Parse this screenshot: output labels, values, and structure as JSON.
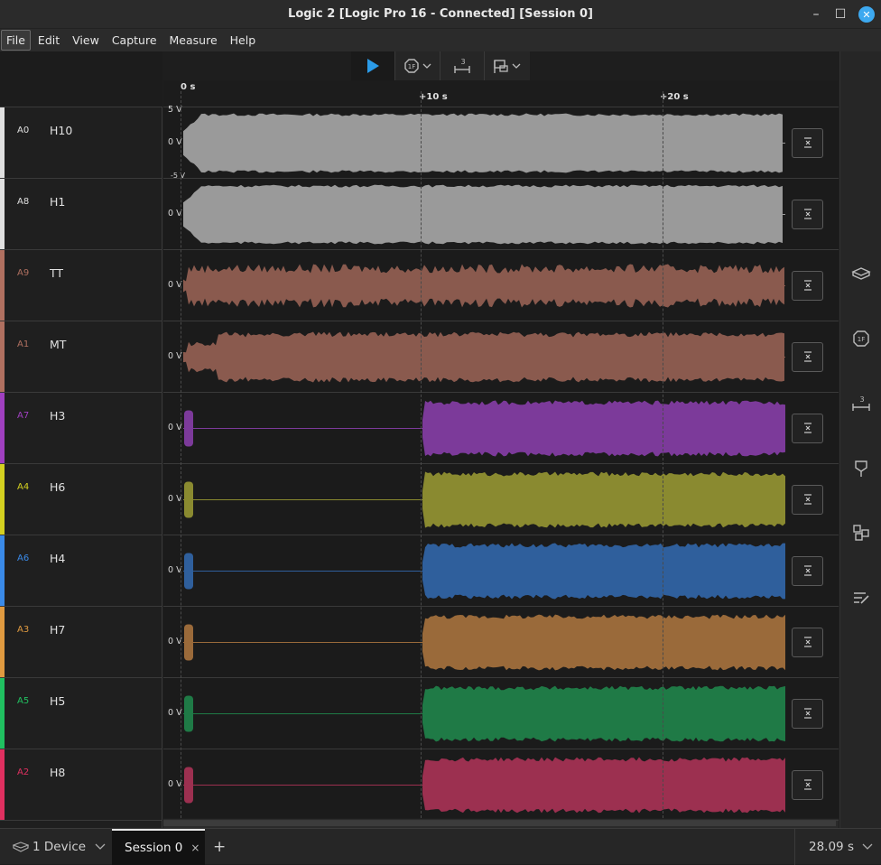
{
  "window": {
    "title": "Logic 2 [Logic Pro 16 - Connected] [Session 0]",
    "minimize_glyph": "–",
    "maximize_glyph": "☐",
    "close_glyph": "✕"
  },
  "menu": [
    "File",
    "Edit",
    "View",
    "Capture",
    "Measure",
    "Help"
  ],
  "toolbar": {
    "start_icon": "play-icon",
    "trigger_icon": "trigger-icon",
    "measure_icon": "measure-icon",
    "measure_count": "3",
    "annotate_icon": "annotate-icon"
  },
  "timeline": {
    "ticks": [
      "0 s",
      "+10 s",
      "+20 s"
    ]
  },
  "channels": [
    {
      "id": "A0",
      "name": "H10",
      "color": "#e0e0e0",
      "wave": "#9a9a9a",
      "ymax": "5 V",
      "zero": "0 V",
      "ymin": "-5 V"
    },
    {
      "id": "A8",
      "name": "H1",
      "color": "#e0e0e0",
      "wave": "#9a9a9a",
      "zero": "0 V"
    },
    {
      "id": "A9",
      "name": "TT",
      "color": "#b07060",
      "wave": "#8a5a4e",
      "zero": "0 V"
    },
    {
      "id": "A1",
      "name": "MT",
      "color": "#b07060",
      "wave": "#8a5a4e",
      "zero": "0 V"
    },
    {
      "id": "A7",
      "name": "H3",
      "color": "#a040c0",
      "wave": "#7c3a9a",
      "zero": "0 V"
    },
    {
      "id": "A4",
      "name": "H6",
      "color": "#d4d020",
      "wave": "#8a8a30",
      "zero": "0 V"
    },
    {
      "id": "A6",
      "name": "H4",
      "color": "#3a8ae8",
      "wave": "#2f5f9c",
      "zero": "0 V"
    },
    {
      "id": "A3",
      "name": "H7",
      "color": "#e09a40",
      "wave": "#9a6a3a",
      "zero": "0 V"
    },
    {
      "id": "A5",
      "name": "H5",
      "color": "#20c060",
      "wave": "#1f7a46",
      "zero": "0 V"
    },
    {
      "id": "A2",
      "name": "H8",
      "color": "#e03060",
      "wave": "#9c3050",
      "zero": "0 V"
    }
  ],
  "right_panel_icons": [
    "device-icon",
    "trigger-icon",
    "measure-icon",
    "marker-icon",
    "extensions-icon",
    "notes-icon"
  ],
  "bottom": {
    "device_label": "1 Device",
    "session_label": "Session 0",
    "session_close": "×",
    "add_tab": "+",
    "duration": "28.09 s"
  }
}
